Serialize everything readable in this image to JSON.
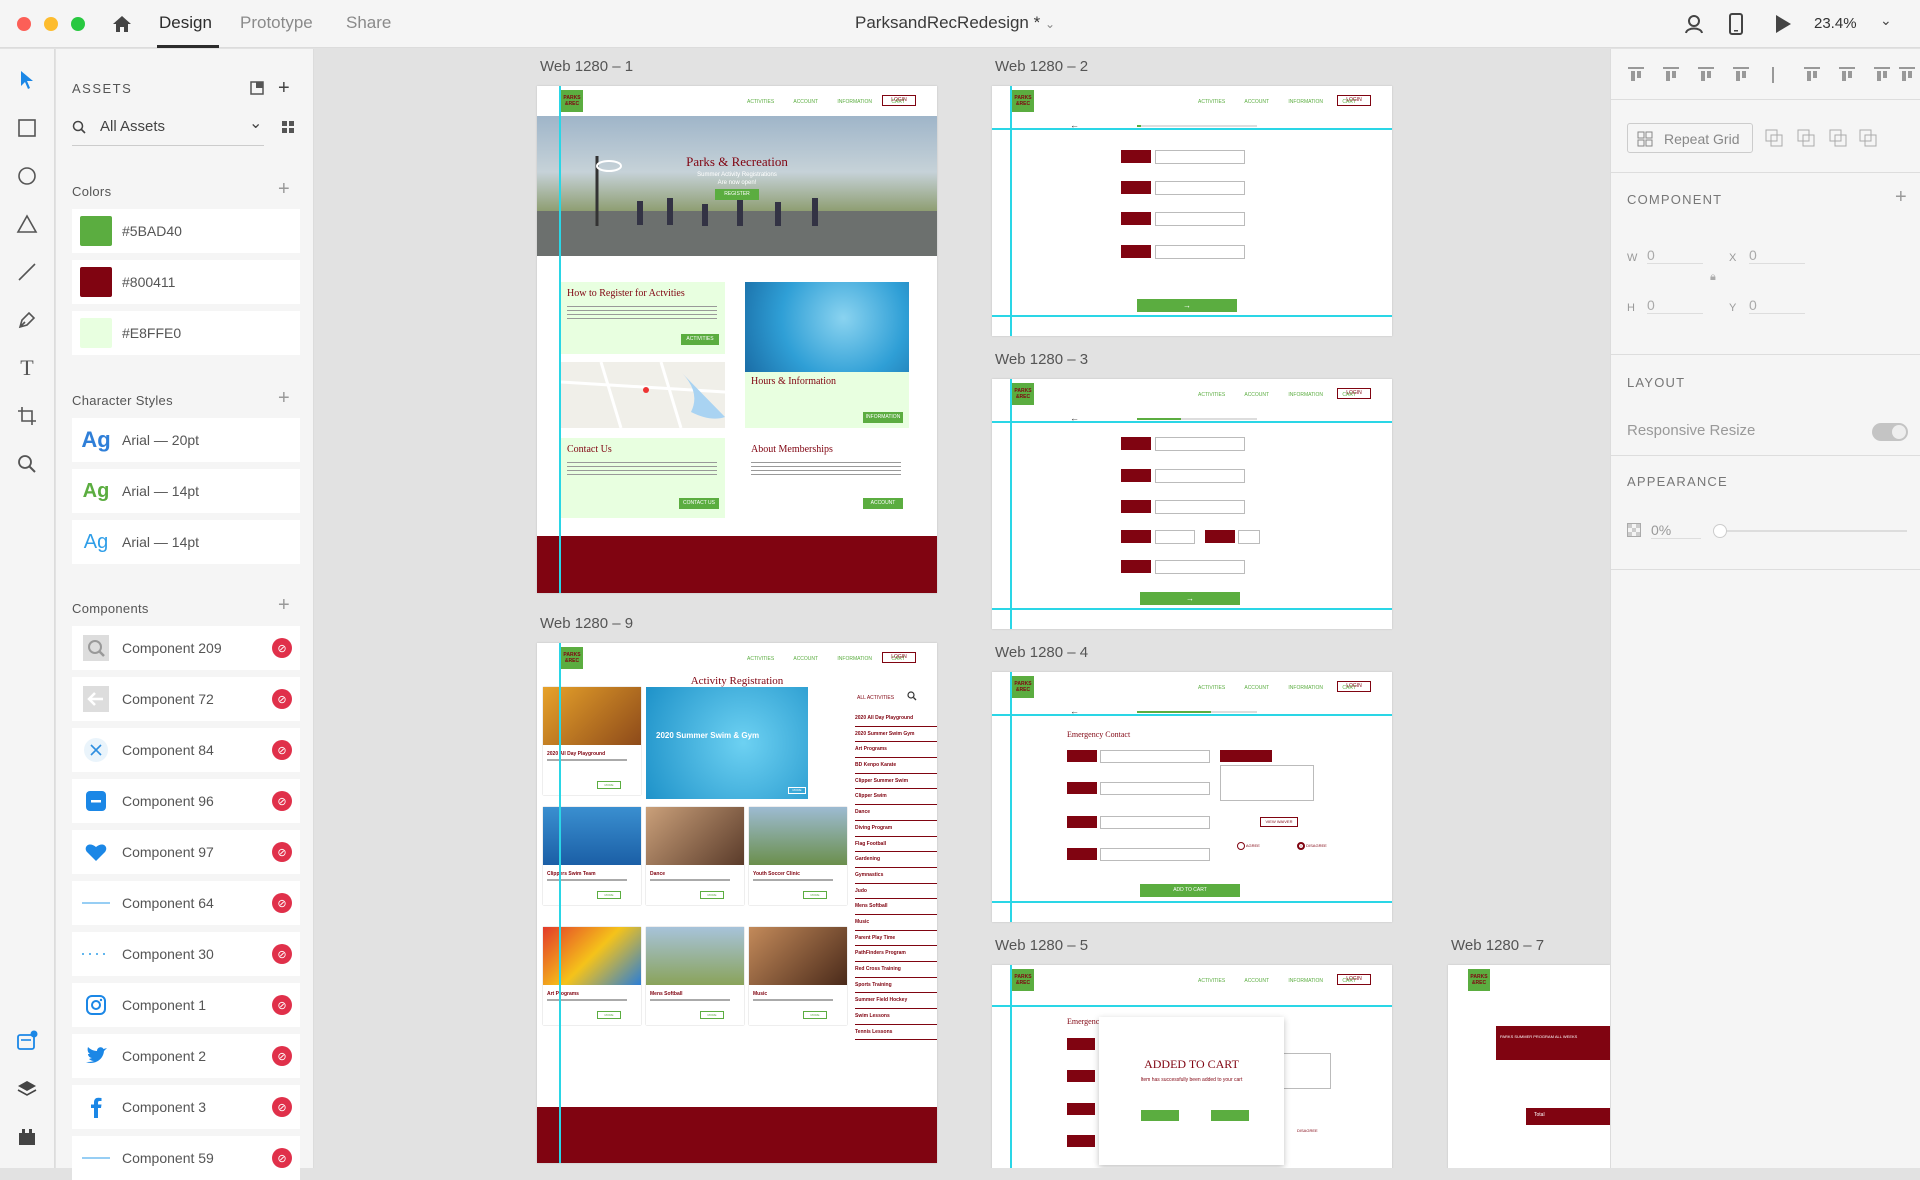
{
  "app": {
    "tabs": [
      "Design",
      "Prototype",
      "Share"
    ],
    "doc_title": "ParksandRecRedesign *",
    "zoom": "23.4%"
  },
  "assets": {
    "title": "ASSETS",
    "search": "All Assets",
    "colors_title": "Colors",
    "colors": [
      {
        "hex": "#5BAD40"
      },
      {
        "hex": "#800411"
      },
      {
        "hex": "#E8FFE0"
      }
    ],
    "char_title": "Character Styles",
    "char_styles": [
      {
        "label": "Arial — 20pt",
        "color": "#2f7fd8"
      },
      {
        "label": "Arial — 14pt",
        "color": "#5bad40"
      },
      {
        "label": "Arial — 14pt",
        "color": "#2f9ee8"
      }
    ],
    "comp_title": "Components",
    "components": [
      {
        "label": "Component 209",
        "icon": "search-icon"
      },
      {
        "label": "Component 72",
        "icon": "arrow-left-icon"
      },
      {
        "label": "Component 84",
        "icon": "close-icon"
      },
      {
        "label": "Component 96",
        "icon": "minus-icon"
      },
      {
        "label": "Component 97",
        "icon": "heart-icon"
      },
      {
        "label": "Component 64",
        "icon": "line-icon"
      },
      {
        "label": "Component 30",
        "icon": "dotted-line-icon"
      },
      {
        "label": "Component 1",
        "icon": "instagram-icon"
      },
      {
        "label": "Component 2",
        "icon": "twitter-icon"
      },
      {
        "label": "Component 3",
        "icon": "facebook-icon"
      },
      {
        "label": "Component 59",
        "icon": "line-icon"
      }
    ]
  },
  "props": {
    "repeat_grid": "Repeat Grid",
    "component": "COMPONENT",
    "w": "W",
    "h": "H",
    "x": "X",
    "y": "Y",
    "zero": "0",
    "layout": "LAYOUT",
    "responsive": "Responsive Resize",
    "appearance": "APPEARANCE",
    "opacity": "0%"
  },
  "artboards": {
    "a1": "Web 1280 – 1",
    "a2": "Web 1280 – 2",
    "a3": "Web 1280 – 3",
    "a4": "Web 1280 – 4",
    "a5": "Web 1280 – 5",
    "a7": "Web 1280 – 7",
    "a9": "Web 1280 – 9"
  },
  "site": {
    "logo": "PARKS &REC",
    "nav": [
      "ACTIVITIES",
      "ACCOUNT",
      "INFORMATION",
      "CART"
    ],
    "login": "LOGIN",
    "hero_title": "Parks & Recreation",
    "hero_sub": "Summer Activity Registrations",
    "hero_sub2": "Are now open!",
    "register": "REGISTER",
    "how_title": "How to Register for Actvities",
    "activities_btn": "ACTIVITIES",
    "hours_title": "Hours & Information",
    "information_btn": "INFORMATION",
    "contact_title": "Contact Us",
    "contact_btn": "CONTACT US",
    "memberships_title": "About Memberships",
    "account_btn": "ACCOUNT",
    "reg_title": "Activity Registration",
    "all_activities": "ALL ACTIVITIES",
    "tiles": [
      "2020 All Day Playground",
      "2020 Summer Swim & Gym",
      "Clippers Swim Team",
      "Dance",
      "Youth Soccer Clinic",
      "Art Programs",
      "Mens Softball",
      "Music"
    ],
    "activity_list": [
      "2020 All Day Playground",
      "2020 Summer Swim Gym",
      "Art Programs",
      "BD Kenpo Karate",
      "Clipper Summer Swim",
      "Clipper Swim",
      "Dance",
      "Diving Program",
      "Flag Football",
      "Gardening",
      "Gymnastics",
      "Judo",
      "Mens Softball",
      "Music",
      "Parent Play Time",
      "PathFinders Program",
      "Red Cross Training",
      "Sports Training",
      "Summer Field Hockey",
      "Swim Lessons",
      "Tennis Lessons"
    ],
    "more": "MORE",
    "emergency": "Emergency Contact",
    "added": "ADDED TO CART",
    "added_sub": "Item has successfully been added to your cart",
    "add_to_cart": "ADD TO CART",
    "view_waiver": "VIEW WAIVER",
    "agree": "AGREE",
    "disagree": "DISAGREE",
    "summer_program": "PARKS SUMMER PROGRAM ALL WEEKS",
    "total": "Total"
  }
}
